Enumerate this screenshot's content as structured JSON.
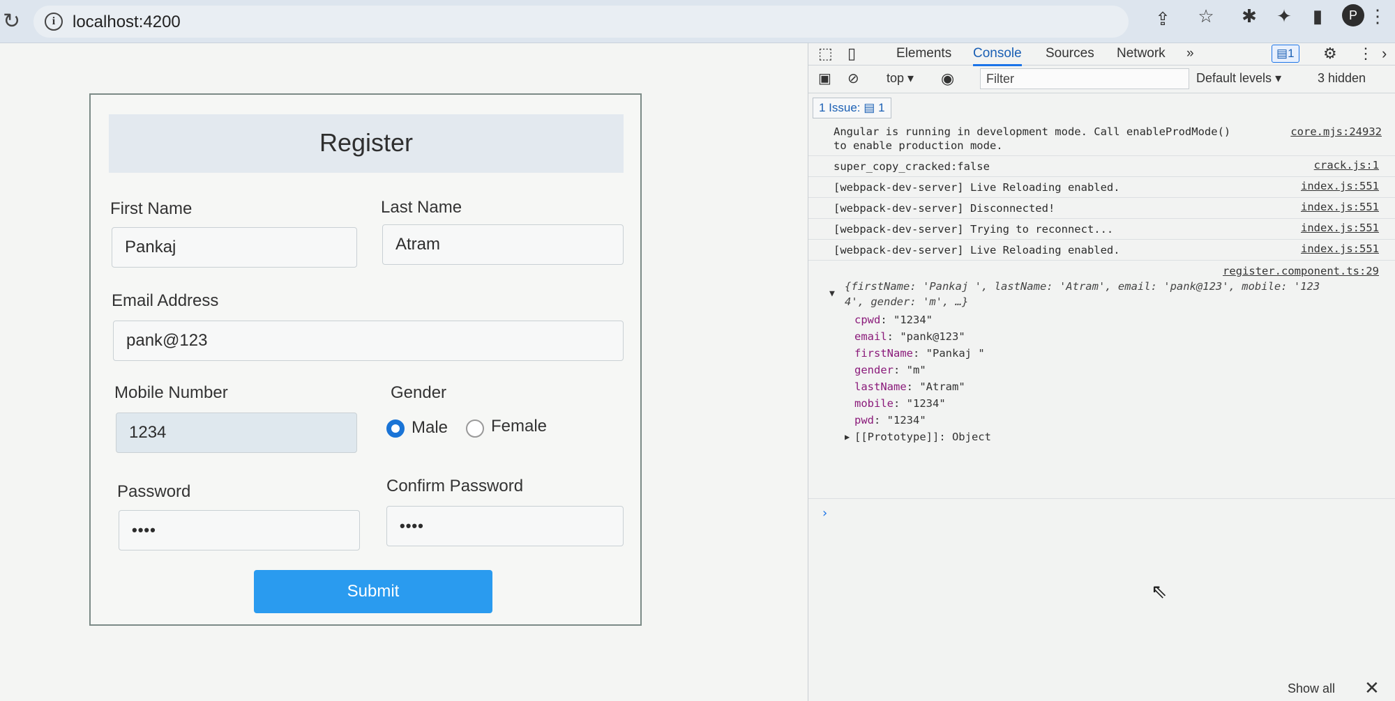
{
  "browser": {
    "url": "localhost:4200",
    "profile_initial": "P"
  },
  "register": {
    "title": "Register",
    "first_name_label": "First Name",
    "first_name_value": "Pankaj",
    "last_name_label": "Last Name",
    "last_name_value": "Atram",
    "email_label": "Email Address",
    "email_value": "pank@123",
    "mobile_label": "Mobile Number",
    "mobile_value": "1234",
    "gender_label": "Gender",
    "gender_options": [
      "Male",
      "Female"
    ],
    "gender_selected": "Male",
    "password_label": "Password",
    "password_value": "••••",
    "confirm_password_label": "Confirm Password",
    "confirm_password_value": "••••",
    "submit_label": "Submit"
  },
  "devtools": {
    "tabs": [
      "Elements",
      "Console",
      "Sources",
      "Network"
    ],
    "active_tab": "Console",
    "more_tabs": "»",
    "message_badge": "1",
    "toolbar": {
      "context": "top",
      "filter_placeholder": "Filter",
      "levels": "Default levels",
      "hidden": "3 hidden"
    },
    "issues": {
      "label": "1 Issue:",
      "count": "1"
    },
    "logs": [
      {
        "message": "Angular is running in development mode. Call enableProdMode()",
        "message2": "to enable production mode.",
        "source": "core.mjs:24932"
      },
      {
        "message": "super_copy_cracked:false",
        "source": "crack.js:1"
      },
      {
        "message": "[webpack-dev-server] Live Reloading enabled.",
        "source": "index.js:551"
      },
      {
        "message": "[webpack-dev-server] Disconnected!",
        "source": "index.js:551"
      },
      {
        "message": "[webpack-dev-server] Trying to reconnect...",
        "source": "index.js:551"
      },
      {
        "message": "[webpack-dev-server] Live Reloading enabled.",
        "source": "index.js:551"
      }
    ],
    "object_log": {
      "source": "register.component.ts:29",
      "summary_line1": "{firstName: 'Pankaj ', lastName: 'Atram', email: 'pank@123', mobile: '123",
      "summary_line2": "4', gender: 'm', …}",
      "properties": [
        {
          "key": "cpwd",
          "value": "\"1234\""
        },
        {
          "key": "email",
          "value": "\"pank@123\""
        },
        {
          "key": "firstName",
          "value": "\"Pankaj \""
        },
        {
          "key": "gender",
          "value": "\"m\""
        },
        {
          "key": "lastName",
          "value": "\"Atram\""
        },
        {
          "key": "mobile",
          "value": "\"1234\""
        },
        {
          "key": "pwd",
          "value": "\"1234\""
        }
      ],
      "prototype": "[[Prototype]]: Object"
    },
    "footer": {
      "show_all": "Show all",
      "close": "✕"
    }
  }
}
